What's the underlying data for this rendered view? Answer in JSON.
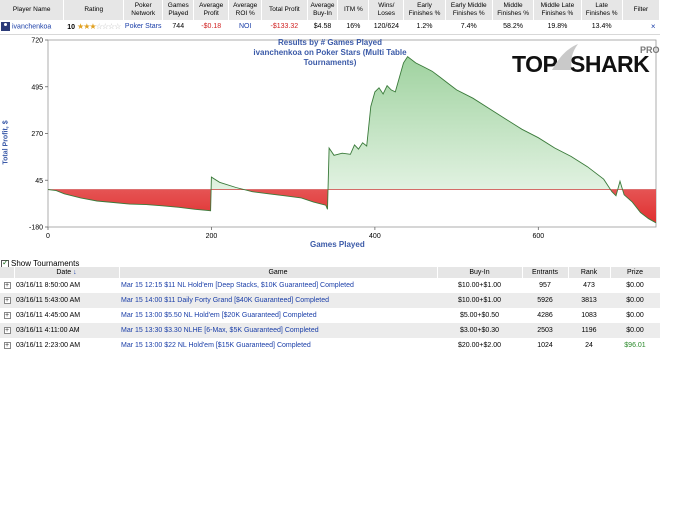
{
  "stats": {
    "headers": [
      "Player Name",
      "Rating",
      "Poker\nNetwork",
      "Games\nPlayed",
      "Average\nProfit",
      "Average\nROI %",
      "Total Profit",
      "Average\nBuy-In",
      "ITM %",
      "Wins/\nLoses",
      "Early\nFinishes %",
      "Early Middle\nFinishes %",
      "Middle\nFinishes %",
      "Middle Late\nFinishes %",
      "Late\nFinishes %",
      "Filter"
    ],
    "row": {
      "player": "ivanchenkoa",
      "rating": "10",
      "stars_filled": 3,
      "stars_total": 7,
      "network": "Poker Stars",
      "games": "744",
      "avg_profit": "-$0.18",
      "avg_roi": "NOI",
      "total_profit": "-$133.32",
      "avg_buyin": "$4.58",
      "itm": "16%",
      "wins_loses": "120/624",
      "early": "1.2%",
      "early_middle": "7.4%",
      "middle": "58.2%",
      "middle_late": "19.8%",
      "late": "13.4%",
      "filter": "×"
    }
  },
  "chart": {
    "title_line1": "Results by # Games Played",
    "title_line2": "ivanchenkoa on Poker Stars (Multi Table Tournaments)",
    "ylabel": "Total Profit, $",
    "xlabel": "Games Played",
    "colors": {
      "line": "#3a7a3a",
      "positive_fill": "#c8e6c8",
      "negative_fill": "#e03030",
      "zero_line": "#d04040"
    }
  },
  "chart_data": {
    "type": "area",
    "title": "Results by # Games Played",
    "subtitle": "ivanchenkoa on Poker Stars (Multi Table Tournaments)",
    "xlabel": "Games Played",
    "ylabel": "Total Profit, $",
    "xlim": [
      0,
      744
    ],
    "ylim": [
      -180,
      720
    ],
    "x_ticks": [
      0,
      200,
      400,
      600
    ],
    "y_ticks": [
      -180,
      45,
      270,
      495,
      720
    ],
    "baseline": 0,
    "x": [
      0,
      10,
      20,
      40,
      60,
      80,
      100,
      120,
      140,
      160,
      180,
      195,
      199,
      200,
      210,
      230,
      250,
      270,
      290,
      310,
      325,
      340,
      342,
      344,
      350,
      360,
      370,
      375,
      380,
      385,
      390,
      395,
      400,
      405,
      410,
      415,
      420,
      425,
      430,
      435,
      440,
      450,
      460,
      470,
      480,
      490,
      500,
      520,
      540,
      560,
      580,
      600,
      620,
      640,
      660,
      680,
      690,
      695,
      700,
      705,
      715,
      725,
      735,
      744
    ],
    "y": [
      0,
      -5,
      -20,
      -40,
      -55,
      -62,
      -70,
      -72,
      -78,
      -85,
      -95,
      -100,
      -102,
      60,
      35,
      10,
      -10,
      -20,
      -30,
      -40,
      -60,
      -75,
      -95,
      200,
      165,
      175,
      170,
      215,
      195,
      225,
      210,
      400,
      470,
      490,
      460,
      500,
      480,
      470,
      540,
      610,
      640,
      610,
      590,
      570,
      540,
      510,
      480,
      440,
      390,
      340,
      290,
      250,
      200,
      160,
      110,
      50,
      -10,
      -30,
      40,
      -25,
      -60,
      -110,
      -140,
      -160
    ]
  },
  "logo": {
    "text_top": "TOP",
    "text_shark": "SHARK",
    "text_pro": "PRO"
  },
  "show_tournaments": {
    "label": "Show Tournaments",
    "checked": true
  },
  "tournaments": {
    "headers": [
      "Date",
      "Game",
      "Buy-In",
      "Entrants",
      "Rank",
      "Prize"
    ],
    "rows": [
      {
        "date": "03/16/11 8:50:00 AM",
        "game": "Mar 15  12:15  $11 NL Hold'em [Deep Stacks, $10K Guaranteed] Completed",
        "buyin": "$10.00+$1.00",
        "entrants": "957",
        "rank": "473",
        "prize": "$0.00"
      },
      {
        "date": "03/16/11 5:43:00 AM",
        "game": "Mar 15  14:00  $11 Daily Forty Grand [$40K Guaranteed] Completed",
        "buyin": "$10.00+$1.00",
        "entrants": "5926",
        "rank": "3813",
        "prize": "$0.00"
      },
      {
        "date": "03/16/11 4:45:00 AM",
        "game": "Mar 15  13:00  $5.50 NL Hold'em [$20K Guaranteed] Completed",
        "buyin": "$5.00+$0.50",
        "entrants": "4286",
        "rank": "1083",
        "prize": "$0.00"
      },
      {
        "date": "03/16/11 4:11:00 AM",
        "game": "Mar 15  13:30  $3.30 NLHE [6-Max, $5K Guaranteed] Completed",
        "buyin": "$3.00+$0.30",
        "entrants": "2503",
        "rank": "1196",
        "prize": "$0.00"
      },
      {
        "date": "03/16/11 2:23:00 AM",
        "game": "Mar 15  13:00  $22 NL Hold'em [$15K Guaranteed] Completed",
        "buyin": "$20.00+$2.00",
        "entrants": "1024",
        "rank": "24",
        "prize": "$96.01"
      }
    ]
  }
}
